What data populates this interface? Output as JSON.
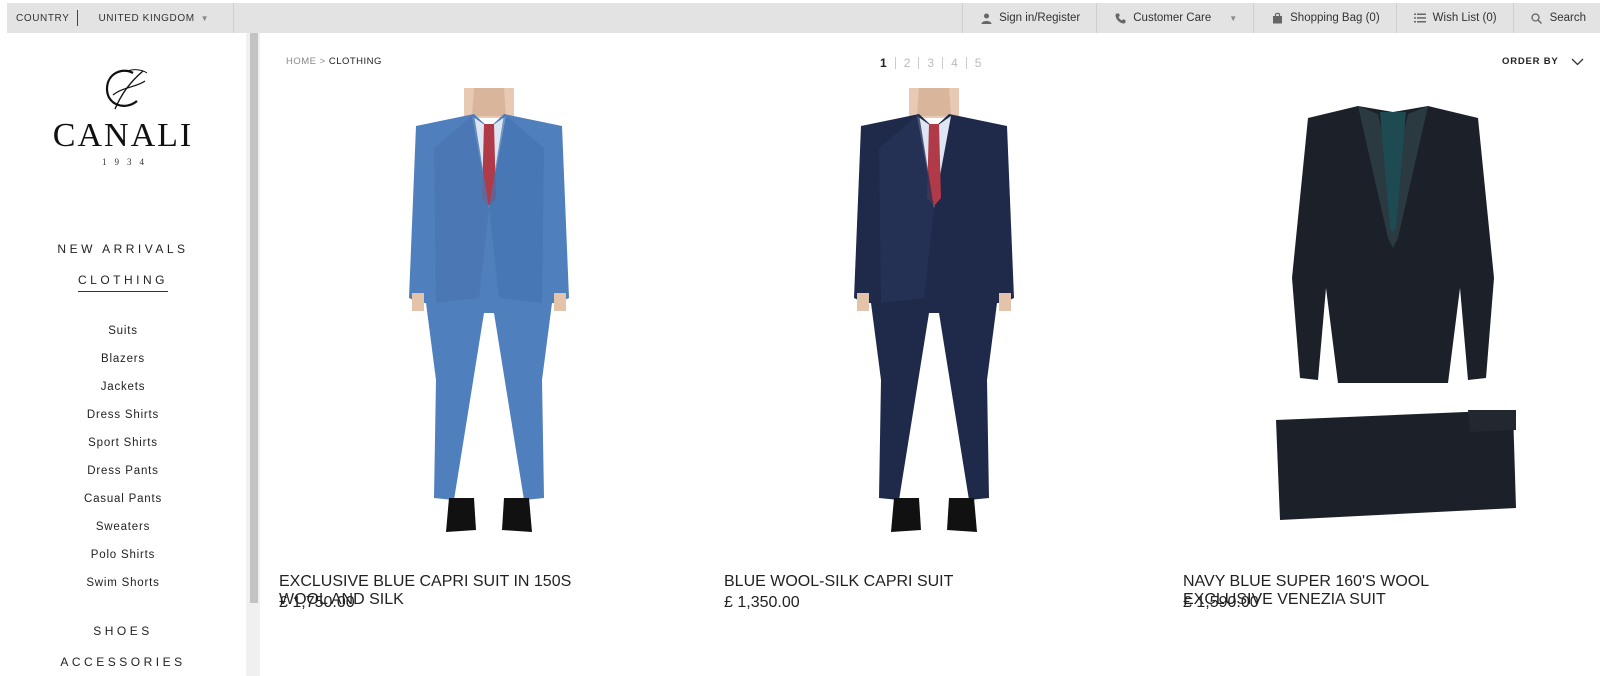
{
  "topbar": {
    "country_label": "COUNTRY",
    "country_value": "UNITED KINGDOM",
    "sign_in": "Sign in/Register",
    "customer_care": "Customer Care",
    "shopping_bag": "Shopping Bag (0)",
    "wish_list": "Wish List (0)",
    "search": "Search"
  },
  "logo": {
    "brand": "CANALI",
    "year": "1934"
  },
  "nav": {
    "new_arrivals": "NEW ARRIVALS",
    "clothing": "CLOTHING",
    "shoes": "SHOES",
    "accessories": "ACCESSORIES",
    "sub_items": [
      "Suits",
      "Blazers",
      "Jackets",
      "Dress Shirts",
      "Sport Shirts",
      "Dress Pants",
      "Casual Pants",
      "Sweaters",
      "Polo Shirts",
      "Swim Shorts"
    ]
  },
  "breadcrumb": {
    "home": "HOME",
    "sep": ">",
    "current": "CLOTHING"
  },
  "pagination": {
    "pages": [
      "1",
      "2",
      "3",
      "4",
      "5"
    ],
    "active": "1"
  },
  "order_by": "ORDER BY",
  "products": [
    {
      "name": "EXCLUSIVE BLUE CAPRI SUIT IN 150S WOOL AND SILK",
      "price": "£ 1,750.00",
      "color": "#4f7fbd"
    },
    {
      "name": "BLUE WOOL-SILK CAPRI SUIT",
      "price": "£ 1,350.00",
      "color": "#1f2a4a"
    },
    {
      "name": "NAVY BLUE SUPER 160'S WOOL EXCLUSIVE VENEZIA SUIT",
      "price": "£ 1,590.00",
      "color": "#1c2028"
    }
  ]
}
